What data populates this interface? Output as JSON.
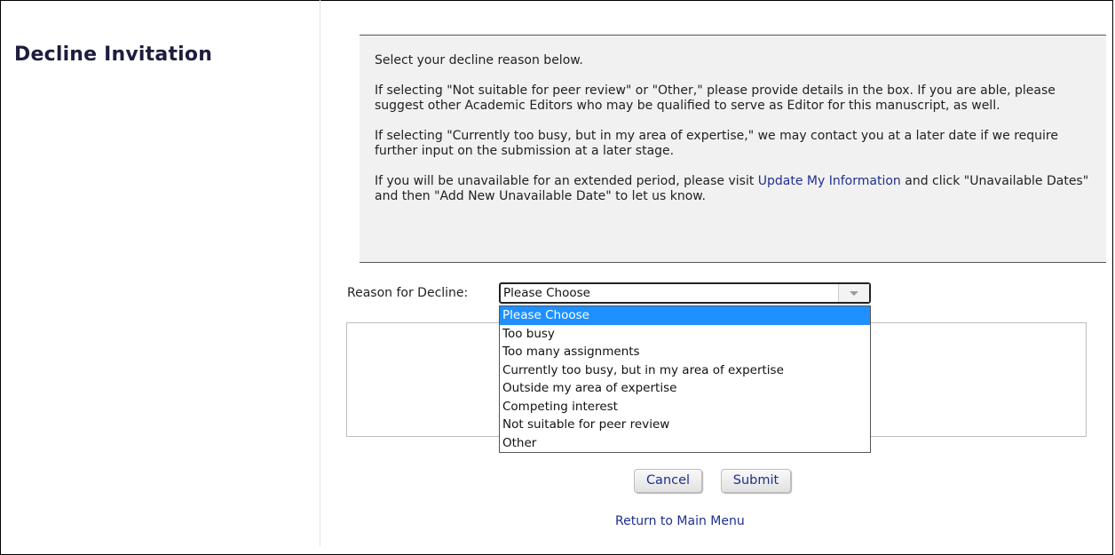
{
  "page": {
    "title": "Decline Invitation"
  },
  "instructions": {
    "p1": "Select your decline reason below.",
    "p2": "If selecting \"Not suitable for peer review\" or \"Other,\" please provide details in the box. If you are able, please suggest other Academic Editors who may be qualified to serve as Editor for this manuscript, as well.",
    "p3": "If selecting \"Currently too busy, but in my area of expertise,\" we may contact you at a later date if we require further input on the submission at a later stage.",
    "p4_before": "If you will be unavailable for an extended period, please visit ",
    "p4_link": "Update My Information",
    "p4_after": " and click \"Unavailable Dates\" and then \"Add New Unavailable Date\" to let us know."
  },
  "form": {
    "reason_label": "Reason for Decline:",
    "selected_value": "Please Choose",
    "options": [
      "Please Choose",
      "Too busy",
      "Too many assignments",
      "Currently too busy, but in my area of expertise",
      "Outside my area of expertise",
      "Competing interest",
      "Not suitable for peer review",
      "Other"
    ],
    "details_value": ""
  },
  "buttons": {
    "cancel": "Cancel",
    "submit": "Submit"
  },
  "links": {
    "main_menu": "Return to Main Menu"
  },
  "colors": {
    "selection_highlight": "#1e90ff",
    "link": "#1f2f8f",
    "instruction_bg": "#f1f1f1"
  },
  "icons": {
    "select_arrow": "chevron-down-icon",
    "resize_grip": "resize-grip-icon"
  }
}
